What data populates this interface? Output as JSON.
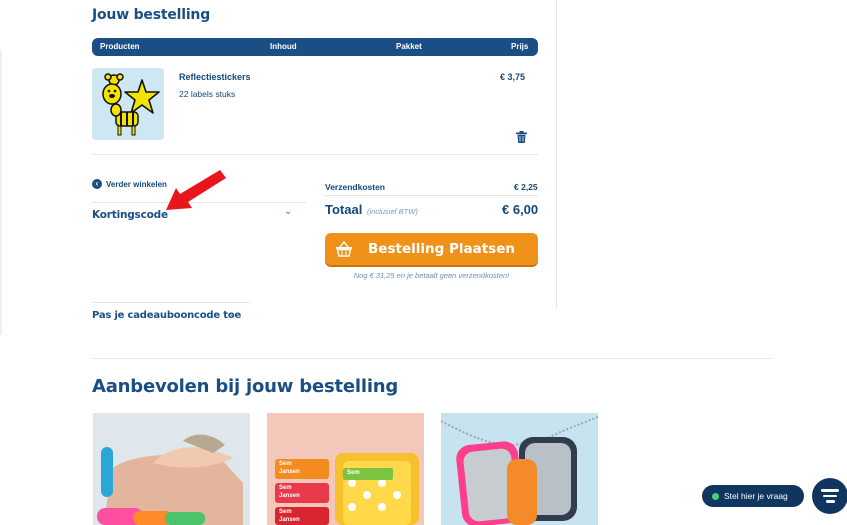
{
  "order": {
    "title": "Jouw bestelling",
    "columns": [
      "Producten",
      "Inhoud",
      "Pakket",
      "Prijs"
    ],
    "item": {
      "name": "Reflectiestickers",
      "quantity": "22 labels stuks",
      "price": "€ 3,75"
    }
  },
  "actions": {
    "continue_shopping": "Verder winkelen",
    "discount_code": "Kortingscode",
    "gift_code": "Pas je cadeaubooncode toe"
  },
  "summary": {
    "shipping_label": "Verzendkosten",
    "shipping_value": "€ 2,25",
    "total_label": "Totaal",
    "total_note": "(inclusief BTW)",
    "total_value": "€ 6,00",
    "order_button": "Bestelling Plaatsen",
    "free_shipping_note": "Nog € 31,25 en je betaalt geen verzendkosten!"
  },
  "recommended": {
    "title": "Aanbevolen bij jouw bestelling",
    "label_text_1": "Sem",
    "label_text_2": "Jansen"
  },
  "support": {
    "help_label": "Stel hier je vraag"
  },
  "colors": {
    "navy": "#1b4e84",
    "orange": "#f0921a",
    "chat_navy": "#10365f",
    "online_green": "#3fd17a"
  }
}
